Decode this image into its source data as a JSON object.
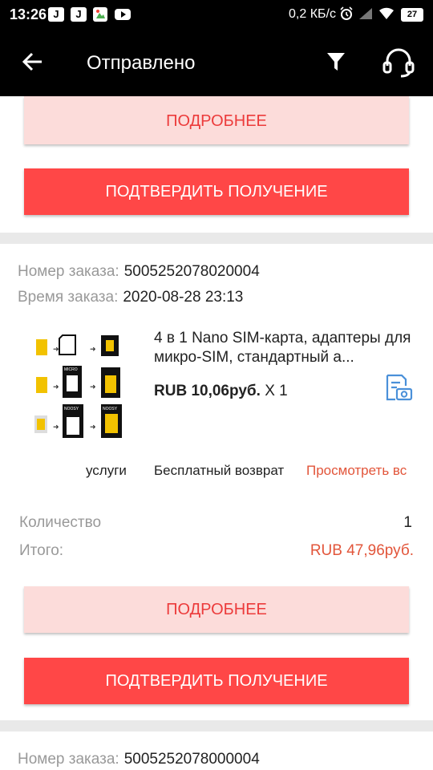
{
  "status_bar": {
    "time": "13:26",
    "app_icons": [
      "J",
      "J",
      "photos-icon",
      "youtube-icon"
    ],
    "speed": "0,2 КБ/с",
    "battery": "27"
  },
  "header": {
    "title": "Отправлено",
    "icons": [
      "back-arrow-icon",
      "filter-icon",
      "headset-icon"
    ]
  },
  "order_top": {
    "details_label": "ПОДРОБНЕЕ",
    "confirm_label": "ПОДТВЕРДИТЬ ПОЛУЧЕНИЕ"
  },
  "order1": {
    "number_label": "Номер заказа:",
    "number": "5005252078020004",
    "time_label": "Время заказа:",
    "time": "2020-08-28 23:13",
    "product": {
      "name": "4 в 1 Nano SIM-карта, адаптеры для микро-SIM, стандартный а...",
      "price": "RUB 10,06руб.",
      "qty_text": "X 1",
      "image_labels": [
        "MICRO",
        "NOOSY",
        "NOOSY"
      ]
    },
    "services_label": "услуги",
    "free_return": "Бесплатный возврат",
    "view_more": "Просмотреть вс",
    "quantity_label": "Количество",
    "quantity": "1",
    "total_label": "Итого:",
    "total": "RUB 47,96руб.",
    "details_label": "ПОДРОБНЕЕ",
    "confirm_label": "ПОДТВЕРДИТЬ ПОЛУЧЕНИЕ"
  },
  "order2": {
    "number_label": "Номер заказа:",
    "number": "5005252078000004"
  },
  "colors": {
    "accent": "#ff4747",
    "details_bg": "#fcdcda",
    "link": "#e2553a"
  }
}
